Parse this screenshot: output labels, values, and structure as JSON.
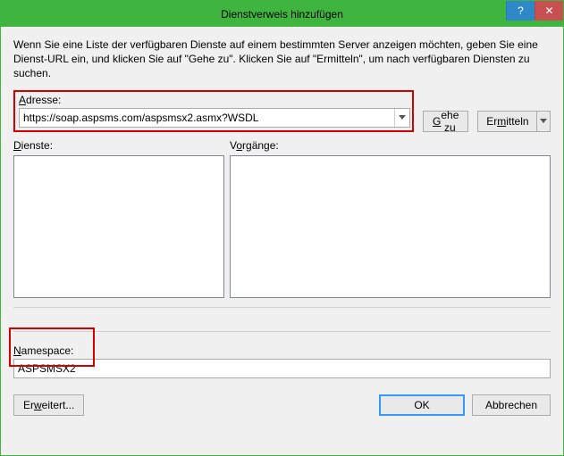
{
  "window": {
    "title": "Dienstverweis hinzufügen"
  },
  "intro": "Wenn Sie eine Liste der verfügbaren Dienste auf einem bestimmten Server anzeigen möchten, geben Sie eine Dienst-URL ein, und klicken Sie auf \"Gehe zu\". Klicken Sie auf \"Ermitteln\", um nach verfügbaren Diensten zu suchen.",
  "address": {
    "label_pre": "",
    "label_key": "A",
    "label_post": "dresse:",
    "value": "https://soap.aspsms.com/aspsmsx2.asmx?WSDL"
  },
  "buttons": {
    "go_pre": "",
    "go_key": "G",
    "go_post": "ehe zu",
    "discover_pre": "Er",
    "discover_key": "m",
    "discover_post": "itteln",
    "advanced_pre": "Er",
    "advanced_key": "w",
    "advanced_post": "eitert...",
    "ok": "OK",
    "cancel": "Abbrechen"
  },
  "lists": {
    "services_pre": "",
    "services_key": "D",
    "services_post": "ienste:",
    "operations_pre": "V",
    "operations_key": "o",
    "operations_post": "rgänge:"
  },
  "namespace": {
    "label_pre": "",
    "label_key": "N",
    "label_post": "amespace:",
    "value": "ASPSMSX2"
  }
}
